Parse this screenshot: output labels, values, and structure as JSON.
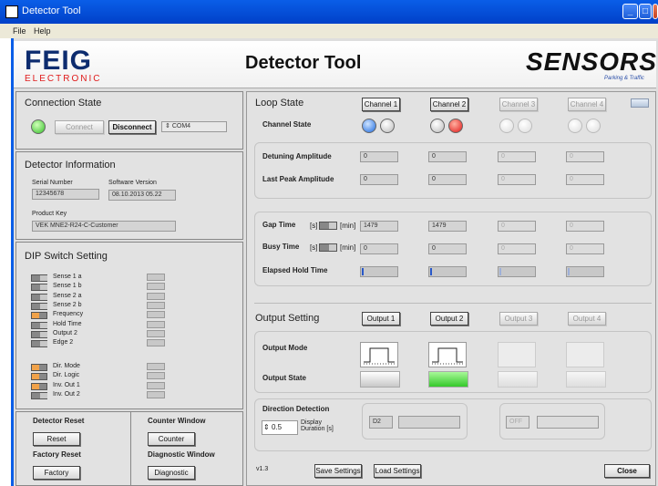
{
  "window": {
    "title": "Detector Tool"
  },
  "menu": [
    "File",
    "Help"
  ],
  "header": {
    "brand": "FEIG",
    "brand_sub": "ELECTRONIC",
    "title": "Detector Tool",
    "partner": "SENSORS",
    "partner_sub": "Parking & Traffic"
  },
  "connection": {
    "title": "Connection State",
    "connect": "Connect",
    "disconnect": "Disconnect",
    "port": "COM4"
  },
  "detector_info": {
    "title": "Detector Information",
    "serial_label": "Serial Number",
    "serial": "12345678",
    "sw_label": "Software Version",
    "sw": "08.10.2013 05.22",
    "key_label": "Product Key",
    "key": "VEK MNE2-R24-C-Customer"
  },
  "dip": {
    "title": "DIP Switch Setting",
    "switches": [
      {
        "label": "Sense 1 a",
        "on": false
      },
      {
        "label": "Sense 1 b",
        "on": false
      },
      {
        "label": "Sense 2 a",
        "on": false
      },
      {
        "label": "Sense 2 b",
        "on": false
      },
      {
        "label": "Frequency",
        "on": true
      },
      {
        "label": "Hold Time",
        "on": false
      },
      {
        "label": "Output 2",
        "on": false
      },
      {
        "label": "Edge 2",
        "on": false
      },
      {
        "label": "Dir. Mode",
        "on": true
      },
      {
        "label": "Dir. Logic",
        "on": true
      },
      {
        "label": "Inv. Out 1",
        "on": true
      },
      {
        "label": "Inv. Out 2",
        "on": false
      }
    ]
  },
  "bottom": {
    "detector_reset": "Detector Reset",
    "reset": "Reset",
    "factory_reset": "Factory Reset",
    "factory": "Factory",
    "counter_window": "Counter Window",
    "counter": "Counter",
    "diagnostic_window": "Diagnostic Window",
    "diagnostic": "Diagnostic"
  },
  "loop": {
    "title": "Loop State",
    "channels": [
      "Channel 1",
      "Channel 2",
      "Channel 3",
      "Channel 4"
    ],
    "channel_state": "Channel State",
    "detuning_label": "Detuning Amplitude",
    "detuning": [
      "0",
      "0",
      "0",
      "0"
    ],
    "peak_label": "Last Peak Amplitude",
    "peak": [
      "0",
      "0",
      "0",
      "0"
    ],
    "gap_label": "Gap Time",
    "gap": [
      "1479",
      "1479",
      "0",
      "0"
    ],
    "busy_label": "Busy Time",
    "busy": [
      "0",
      "0",
      "0",
      "0"
    ],
    "unit_s": "[s]",
    "unit_min": "[min]",
    "elapsed_label": "Elapsed Hold Time",
    "elapsed": [
      0.01,
      0.01,
      0.01,
      0.01
    ]
  },
  "output": {
    "title": "Output Setting",
    "outputs": [
      "Output 1",
      "Output 2",
      "Output 3",
      "Output 4"
    ],
    "mode_label": "Output Mode",
    "state_label": "Output State"
  },
  "direction": {
    "title": "Direction Detection",
    "duration": "0.5",
    "duration_label": "Display Duration [s]",
    "d1": "D2",
    "d2": "OFF"
  },
  "footer": {
    "version": "v1.3",
    "save": "Save Settings",
    "load": "Load Settings",
    "close": "Close"
  },
  "colors": {
    "accent_blue": "#1d6be0",
    "state_red": "#e01818",
    "state_green": "#34c82a",
    "dip_on": "#f0a24a",
    "brand": "#0d2c6f"
  }
}
